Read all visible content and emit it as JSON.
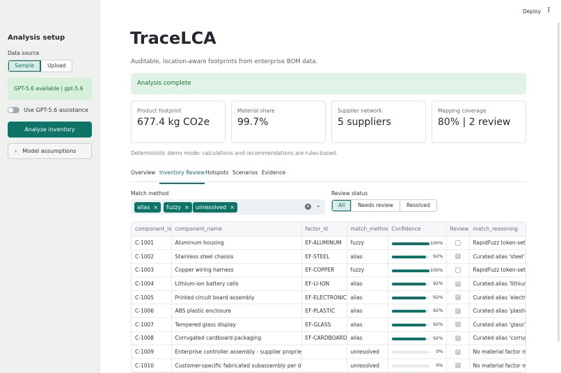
{
  "topbar": {
    "deploy": "Deploy",
    "menu": "⋮"
  },
  "sidebar": {
    "title": "Analysis setup",
    "source_label": "Data source",
    "source_options": [
      "Sample",
      "Upload"
    ],
    "model_info": "GPT-5.6 available | gpt-5.6",
    "assist_label": "Use GPT-5.6 assistance",
    "analyze_button": "Analyze inventory",
    "assumptions": "Model assumptions",
    "chevron": "›"
  },
  "header": {
    "title": "TraceLCA",
    "subtitle": "Auditable, location-aware footprints from enterprise BOM data."
  },
  "status": "Analysis complete",
  "metrics": [
    {
      "label": "Product footprint",
      "value": "677.4 kg CO2e"
    },
    {
      "label": "Material share",
      "value": "99.7%"
    },
    {
      "label": "Supplier network",
      "value": "5 suppliers"
    },
    {
      "label": "Mapping coverage",
      "value": "80% | 2 review"
    }
  ],
  "note": "Deterministic demo mode: calculations and recommendations are rules-based.",
  "tabs": [
    "Overview",
    "Inventory Review",
    "Hotspots",
    "Scenarios",
    "Evidence"
  ],
  "filters": {
    "match_label": "Match method",
    "chips": [
      "alias",
      "fuzzy",
      "unresolved"
    ],
    "chip_x": "×",
    "clear": "×",
    "dropdown": "⌄",
    "review_label": "Review status",
    "review_options": [
      "All",
      "Needs review",
      "Resolved"
    ]
  },
  "table": {
    "columns": [
      "component_id",
      "component_name",
      "factor_id",
      "match_method",
      "Confidence",
      "Review",
      "match_reasoning"
    ],
    "rows": [
      {
        "id": "C-1001",
        "name": "Aluminum housing",
        "factor": "EF-ALUMINUM",
        "method": "fuzzy",
        "confidence": 100,
        "conf_label": "100%",
        "review": false,
        "reasoning": "RapidFuzz token-set match"
      },
      {
        "id": "C-1002",
        "name": "Stainless steel chassis",
        "factor": "EF-STEEL",
        "method": "alias",
        "confidence": 92,
        "conf_label": "92%",
        "review": true,
        "reasoning": "Curated alias 'steel' matched"
      },
      {
        "id": "C-1003",
        "name": "Copper wiring harness",
        "factor": "EF-COPPER",
        "method": "fuzzy",
        "confidence": 100,
        "conf_label": "100%",
        "review": false,
        "reasoning": "RapidFuzz token-set match"
      },
      {
        "id": "C-1004",
        "name": "Lithium-ion battery cells",
        "factor": "EF-LI-ION",
        "method": "alias",
        "confidence": 92,
        "conf_label": "92%",
        "review": true,
        "reasoning": "Curated alias 'lithium ion'"
      },
      {
        "id": "C-1005",
        "name": "Printed circuit board assembly",
        "factor": "EF-ELECTRONICS",
        "method": "alias",
        "confidence": 92,
        "conf_label": "92%",
        "review": true,
        "reasoning": "Curated alias 'electronics'"
      },
      {
        "id": "C-1006",
        "name": "ABS plastic enclosure",
        "factor": "EF-PLASTIC",
        "method": "alias",
        "confidence": 92,
        "conf_label": "92%",
        "review": true,
        "reasoning": "Curated alias 'plastic' matched"
      },
      {
        "id": "C-1007",
        "name": "Tempered glass display",
        "factor": "EF-GLASS",
        "method": "alias",
        "confidence": 92,
        "conf_label": "92%",
        "review": true,
        "reasoning": "Curated alias 'glass' matched"
      },
      {
        "id": "C-1008",
        "name": "Corrugated cardboard packaging",
        "factor": "EF-CARDBOARD",
        "method": "alias",
        "confidence": 92,
        "conf_label": "92%",
        "review": true,
        "reasoning": "Curated alias 'corrugated'"
      },
      {
        "id": "C-1009",
        "name": "Enterprise controller assembly - supplier proprietary component",
        "factor": "",
        "method": "unresolved",
        "confidence": 0,
        "conf_label": "0%",
        "review": true,
        "reasoning": "No material factor met"
      },
      {
        "id": "C-1010",
        "name": "Customer-specific fabricated subassembly per drawing",
        "factor": "",
        "method": "unresolved",
        "confidence": 0,
        "conf_label": "0%",
        "review": true,
        "reasoning": "No material factor met"
      }
    ]
  }
}
